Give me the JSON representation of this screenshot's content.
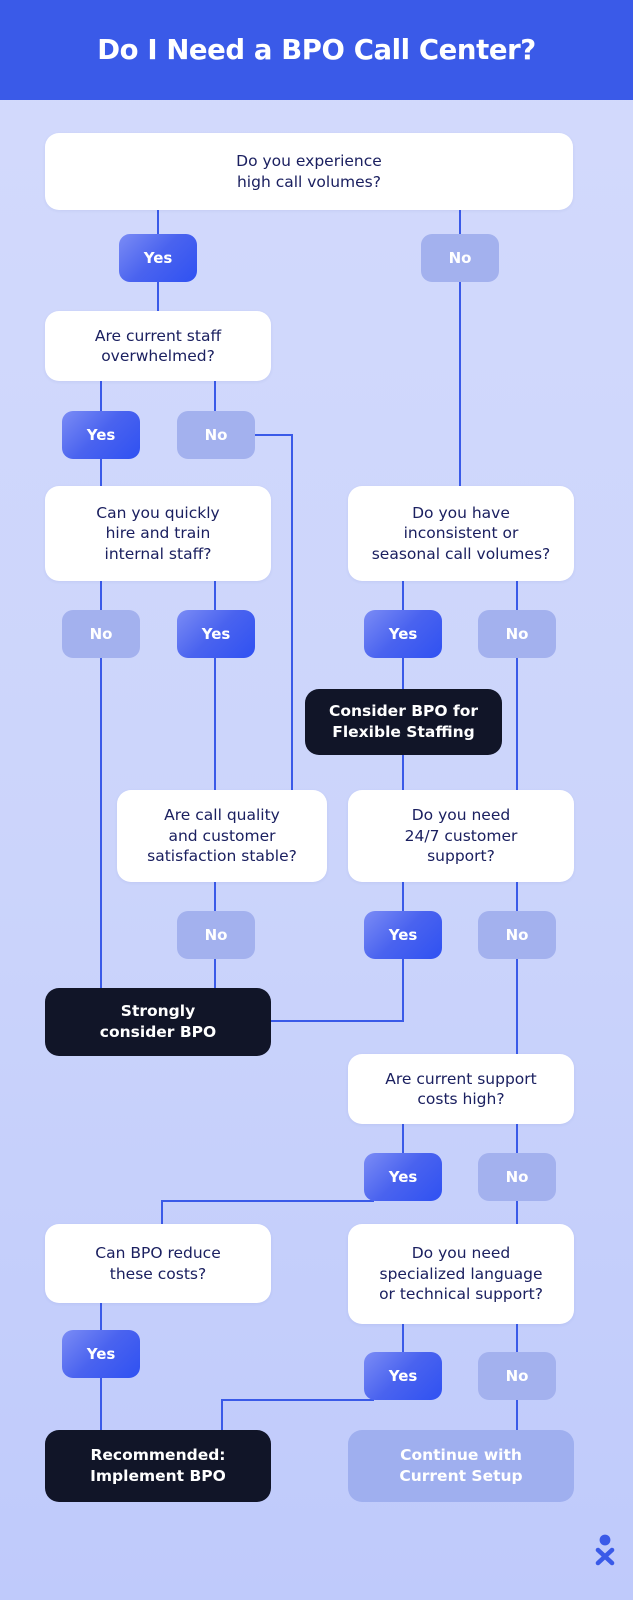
{
  "header": {
    "title": "Do I Need a BPO Call Center?"
  },
  "theme": {
    "header_bg": "#3a5ae8",
    "page_bg_top": "#d3dafc",
    "page_bg_bottom": "#bfcafb",
    "question_bg": "#ffffff",
    "question_text": "#1b2060",
    "yes_pill": "#3a5ae8",
    "no_pill": "#a3b1ee",
    "outcome_bg": "#111528",
    "outcome_text": "#ffffff",
    "muted_outcome_bg": "#9fafef",
    "connector": "#3a5ae8"
  },
  "flowchart": {
    "type": "decision-tree",
    "questions": [
      {
        "id": "q1",
        "text": "Do you experience\nhigh call volumes?"
      },
      {
        "id": "q2",
        "text": "Are current staff\noverwhelmed?"
      },
      {
        "id": "q3",
        "text": "Can you quickly\nhire and train\ninternal staff?"
      },
      {
        "id": "q4",
        "text": "Do you have\ninconsistent or\nseasonal call volumes?"
      },
      {
        "id": "q5",
        "text": "Are call quality\nand customer\nsatisfaction stable?"
      },
      {
        "id": "q6",
        "text": "Do you need\n24/7 customer\nsupport?"
      },
      {
        "id": "q7",
        "text": "Are current support\ncosts high?"
      },
      {
        "id": "q8",
        "text": "Can BPO reduce\nthese costs?"
      },
      {
        "id": "q9",
        "text": "Do you need\nspecialized language\nor technical support?"
      }
    ],
    "outcomes": [
      {
        "id": "o1",
        "text": "Consider BPO for\nFlexible Staffing",
        "style": "dark"
      },
      {
        "id": "o2",
        "text": "Strongly\nconsider BPO",
        "style": "dark"
      },
      {
        "id": "o3",
        "text": "Recommended:\nImplement BPO",
        "style": "dark"
      },
      {
        "id": "o4",
        "text": "Continue with\nCurrent Setup",
        "style": "muted"
      }
    ],
    "labels": {
      "yes": "Yes",
      "no": "No"
    },
    "branches": [
      {
        "id": "b1",
        "from": "q1",
        "label": "Yes",
        "kind": "yes",
        "to": "q2"
      },
      {
        "id": "b2",
        "from": "q1",
        "label": "No",
        "kind": "no",
        "to": "q4"
      },
      {
        "id": "b3",
        "from": "q2",
        "label": "Yes",
        "kind": "yes",
        "to": "q3"
      },
      {
        "id": "b4",
        "from": "q2",
        "label": "No",
        "kind": "no",
        "to": "q5"
      },
      {
        "id": "b5",
        "from": "q3",
        "label": "No",
        "kind": "no",
        "to": "o2"
      },
      {
        "id": "b6",
        "from": "q3",
        "label": "Yes",
        "kind": "yes",
        "to": "q5"
      },
      {
        "id": "b7",
        "from": "q4",
        "label": "Yes",
        "kind": "yes",
        "to": "o1"
      },
      {
        "id": "b8",
        "from": "q4",
        "label": "No",
        "kind": "no",
        "to": "q6"
      },
      {
        "id": "b9",
        "from": "q5",
        "label": "No",
        "kind": "no",
        "to": "o2"
      },
      {
        "id": "b10",
        "from": "q6",
        "label": "Yes",
        "kind": "yes",
        "to": "o2"
      },
      {
        "id": "b11",
        "from": "q6",
        "label": "No",
        "kind": "no",
        "to": "q7"
      },
      {
        "id": "b12",
        "from": "q7",
        "label": "Yes",
        "kind": "yes",
        "to": "q8"
      },
      {
        "id": "b13",
        "from": "q7",
        "label": "No",
        "kind": "no",
        "to": "q9"
      },
      {
        "id": "b14",
        "from": "q8",
        "label": "Yes",
        "kind": "yes",
        "to": "o3"
      },
      {
        "id": "b15",
        "from": "q9",
        "label": "Yes",
        "kind": "yes",
        "to": "o3"
      },
      {
        "id": "b16",
        "from": "q9",
        "label": "No",
        "kind": "no",
        "to": "o4"
      }
    ]
  },
  "logo": {
    "name": "person-x-logo"
  }
}
